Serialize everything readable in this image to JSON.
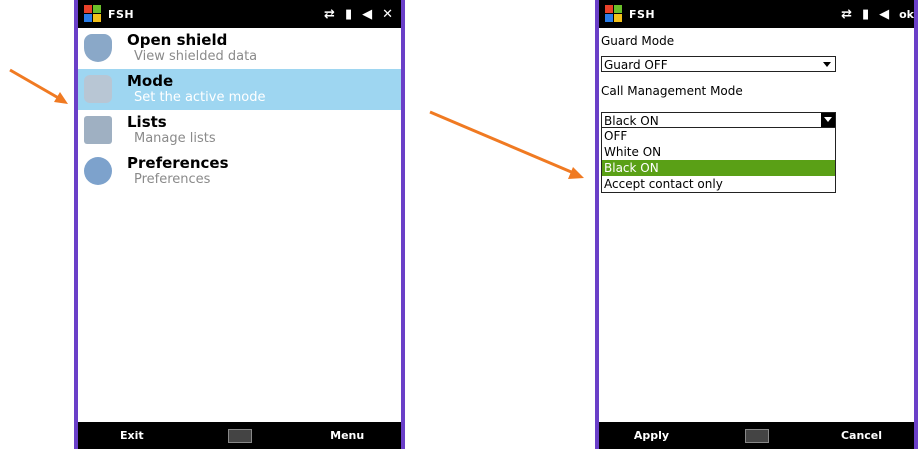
{
  "colors": {
    "frame": "#6a3fc8",
    "highlight": "#9ed6f1",
    "selected_option": "#5aa016",
    "annotation_arrow": "#f07a22"
  },
  "phone1": {
    "app_title": "FSH",
    "status_icons": [
      "sync-icon",
      "signal-icon",
      "volume-icon"
    ],
    "close_label": "✕",
    "menu": [
      {
        "title": "Open shield",
        "subtitle": "View shielded data",
        "icon": "shield-icon"
      },
      {
        "title": "Mode",
        "subtitle": "Set the active mode",
        "icon": "mode-icon"
      },
      {
        "title": "Lists",
        "subtitle": "Manage lists",
        "icon": "lists-icon"
      },
      {
        "title": "Preferences",
        "subtitle": "Preferences",
        "icon": "preferences-icon"
      }
    ],
    "softkeys": {
      "left": "Exit",
      "right": "Menu"
    }
  },
  "phone2": {
    "app_title": "FSH",
    "status_icons": [
      "sync-icon",
      "signal-icon",
      "volume-icon"
    ],
    "ok_label": "ok",
    "guard_label": "Guard Mode",
    "guard_value": "Guard OFF",
    "call_label": "Call Management Mode",
    "call_value": "Black ON",
    "options": [
      "OFF",
      "White ON",
      "Black ON",
      "Accept contact only"
    ],
    "softkeys": {
      "left": "Apply",
      "right": "Cancel"
    }
  }
}
